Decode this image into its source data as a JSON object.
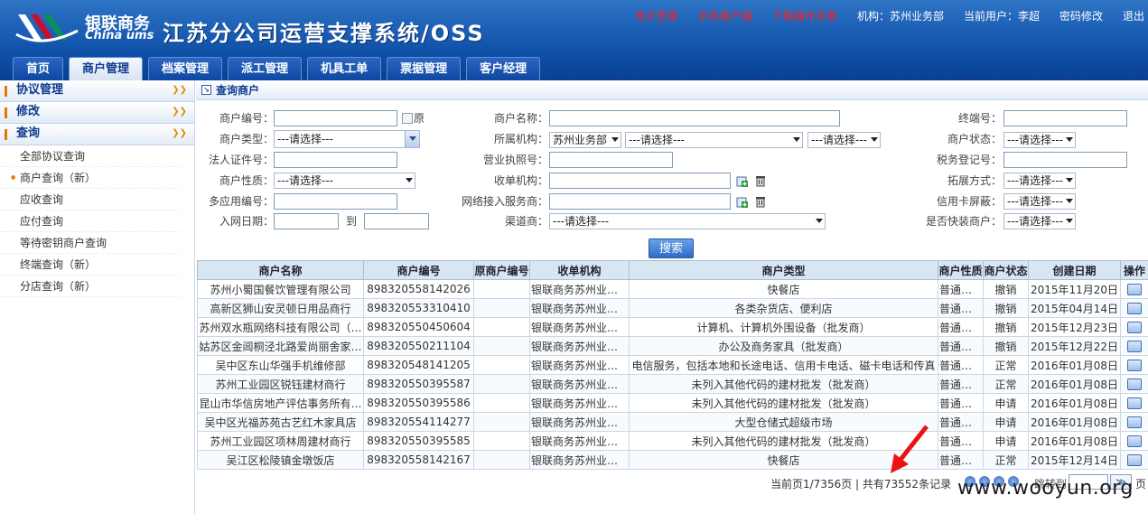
{
  "header": {
    "logo_cn": "银联商务",
    "logo_en": "China ums",
    "app_title": "江苏分公司运营支撑系统/OSS",
    "links": [
      "电子签章",
      "手机客户端",
      "下载操作手册"
    ],
    "org_label": "机构：苏州业务部",
    "user_label": "当前用户：李超",
    "change_pwd": "密码修改",
    "logout": "退出"
  },
  "nav": {
    "tabs": [
      "首页",
      "商户管理",
      "档案管理",
      "派工管理",
      "机具工单",
      "票据管理",
      "客户经理"
    ],
    "active": "商户管理"
  },
  "sidebar": {
    "groups": [
      {
        "label": "协议管理"
      },
      {
        "label": "修改"
      },
      {
        "label": "查询"
      }
    ],
    "items": [
      "全部协议查询",
      "商户查询（新）",
      "应收查询",
      "应付查询",
      "等待密钥商户查询",
      "终端查询（新）",
      "分店查询（新）"
    ],
    "current_item": "商户查询（新）"
  },
  "section_title": "查询商户",
  "form": {
    "merchant_no_label": "商户编号：",
    "orig_label": "原",
    "merchant_name_label": "商户名称：",
    "terminal_no_label": "终端号：",
    "merchant_type_label": "商户类型：",
    "merchant_type_value": "---请选择---",
    "org_label": "所属机构：",
    "org_value_1": "苏州业务部",
    "org_value_2": "---请选择---",
    "org_value_3": "---请选择---",
    "merchant_status_label": "商户状态：",
    "merchant_status_value": "---请选择---",
    "legal_id_label": "法人证件号：",
    "license_label": "营业执照号：",
    "tax_label": "税务登记号：",
    "merchant_nature_label": "商户性质：",
    "merchant_nature_value": "---请选择---",
    "acquirer_label": "收单机构：",
    "expand_label": "拓展方式：",
    "expand_value": "---请选择---",
    "multi_no_label": "多应用编号：",
    "network_label": "网络接入服务商：",
    "credit_label": "信用卡屏蔽：",
    "credit_value": "---请选择---",
    "join_date_label": "入网日期：",
    "to_label": "到",
    "channel_label": "渠道商：",
    "channel_value": "---请选择---",
    "quickpay_label": "是否快装商户：",
    "quickpay_value": "---请选择---",
    "search_button": "搜索"
  },
  "table": {
    "headers": [
      "商户名称",
      "商户编号",
      "原商户编号",
      "收单机构",
      "商户类型",
      "商户性质",
      "商户状态",
      "创建日期",
      "操作"
    ],
    "rows": [
      [
        "苏州小蜀国餐饮管理有限公司",
        "898320558142026",
        "",
        "银联商务苏州业务部",
        "快餐店",
        "普通商户",
        "撤销",
        "2015年11月20日"
      ],
      [
        "高新区狮山安灵顿日用品商行",
        "898320553310410",
        "",
        "银联商务苏州业务部",
        "各类杂货店、便利店",
        "普通商户",
        "撤销",
        "2015年04月14日"
      ],
      [
        "苏州双水瓶网络科技有限公司（…",
        "898320550450604",
        "",
        "银联商务苏州业务部",
        "计算机、计算机外围设备（批发商）",
        "普通商户",
        "撤销",
        "2015年12月23日"
      ],
      [
        "姑苏区金阊桐泾北路爱尚丽舍家…",
        "898320550211104",
        "",
        "银联商务苏州业务部",
        "办公及商务家具（批发商）",
        "普通商户",
        "撤销",
        "2015年12月22日"
      ],
      [
        "吴中区东山华强手机维修部",
        "898320548141205",
        "",
        "银联商务苏州业务部",
        "电信服务，包括本地和长途电话、信用卡电话、磁卡电话和传真",
        "普通商户",
        "正常",
        "2016年01月08日"
      ],
      [
        "苏州工业园区锐钰建材商行",
        "898320550395587",
        "",
        "银联商务苏州业务部",
        "未列入其他代码的建材批发（批发商）",
        "普通商户",
        "正常",
        "2016年01月08日"
      ],
      [
        "昆山市华信房地产评估事务所有…",
        "898320550395586",
        "",
        "银联商务苏州业务部",
        "未列入其他代码的建材批发（批发商）",
        "普通商户",
        "申请",
        "2016年01月08日"
      ],
      [
        "吴中区光福苏苑古艺红木家具店",
        "898320554114277",
        "",
        "银联商务苏州业务部",
        "大型仓储式超级市场",
        "普通商户",
        "申请",
        "2016年01月08日"
      ],
      [
        "苏州工业园区项林周建材商行",
        "898320550395585",
        "",
        "银联商务苏州业务部",
        "未列入其他代码的建材批发（批发商）",
        "普通商户",
        "申请",
        "2016年01月08日"
      ],
      [
        "吴江区松陵镇金墩饭店",
        "898320558142167",
        "",
        "银联商务苏州业务部",
        "快餐店",
        "普通商户",
        "正常",
        "2015年12月14日"
      ]
    ]
  },
  "pager": {
    "summary": "当前页1/7356页 | 共有73552条记录",
    "jump_label": "跳转到",
    "tail": "页"
  },
  "watermark": "www.wooyun.org",
  "colors": {
    "header_blue": "#1b5eb4",
    "accent_red": "#ff2020",
    "table_header": "#d8e6f2"
  }
}
